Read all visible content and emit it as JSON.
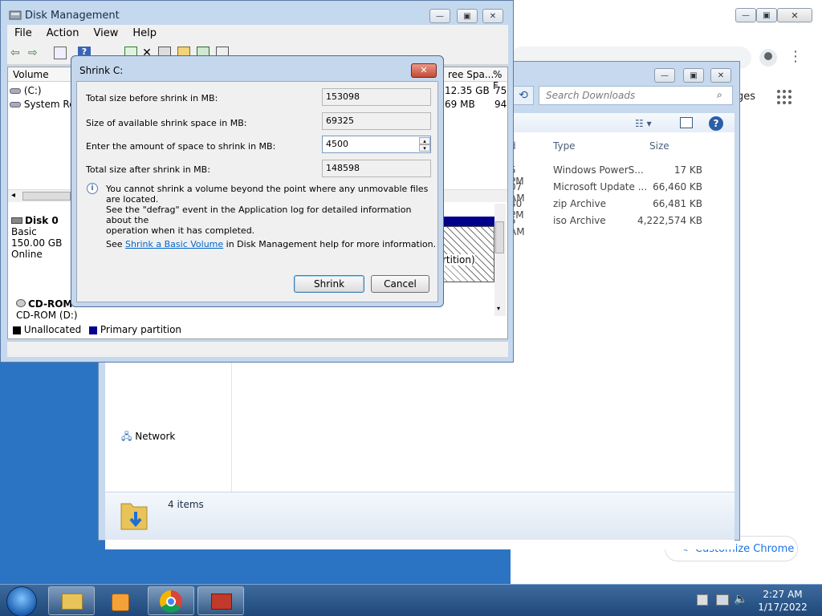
{
  "chrome": {
    "images_label": "ges",
    "customize_label": "Customize Chrome"
  },
  "explorer": {
    "search_placeholder": "Search Downloads",
    "columns": {
      "date_fragment": "d",
      "type": "Type",
      "size": "Size"
    },
    "rows": [
      {
        "date": "5 PM",
        "type": "Windows PowerS...",
        "size": "17 KB"
      },
      {
        "date": "07 AM",
        "type": "Microsoft Update ...",
        "size": "66,460 KB"
      },
      {
        "date": "40 PM",
        "type": "zip Archive",
        "size": "66,481 KB"
      },
      {
        "date": "5 AM",
        "type": "iso Archive",
        "size": "4,222,574 KB"
      }
    ],
    "nav_network": "Network",
    "item_count": "4 items"
  },
  "disk_management": {
    "title": "Disk Management",
    "menu": [
      "File",
      "Action",
      "View",
      "Help"
    ],
    "volume_header": "Volume",
    "free_space_header": "ree Spa...",
    "pct_header": "% F",
    "volumes": [
      {
        "name": "(C:)",
        "free": "12.35 GB",
        "pct": "75"
      },
      {
        "name": "System Res",
        "free": "69 MB",
        "pct": "94"
      }
    ],
    "disk0": {
      "name": "Disk 0",
      "type": "Basic",
      "size": "150.00 GB",
      "status": "Online"
    },
    "partition_label": "rtition)",
    "cdrom": {
      "name": "CD-ROM",
      "drive": "CD-ROM (D:)"
    },
    "legend": {
      "unallocated": "Unallocated",
      "primary": "Primary partition"
    }
  },
  "dialog": {
    "title": "Shrink C:",
    "close_label": "✕",
    "fields": [
      {
        "label": "Total size before shrink in MB:",
        "value": "153098"
      },
      {
        "label": "Size of available shrink space in MB:",
        "value": "69325"
      },
      {
        "label": "Enter the amount of space to shrink in MB:",
        "value": "4500"
      },
      {
        "label": "Total size after shrink in MB:",
        "value": "148598"
      }
    ],
    "info_text_1": "You cannot shrink a volume beyond the point where any unmovable files are located.",
    "info_text_2": "See the \"defrag\" event in the Application log for detailed information about the",
    "info_text_3": "operation when it has completed.",
    "help_prefix": "See ",
    "help_link": "Shrink a Basic Volume",
    "help_suffix": " in Disk Management help for more information.",
    "shrink_button": "Shrink",
    "cancel_button": "Cancel"
  },
  "taskbar": {
    "time": "2:27 AM",
    "date": "1/17/2022"
  },
  "colors": {
    "desktop": "#2b74c4",
    "window_frame": "#c4d8ee",
    "link": "#0066cc",
    "primary_partition": "#00008b",
    "chrome_accent": "#1a73e8"
  }
}
